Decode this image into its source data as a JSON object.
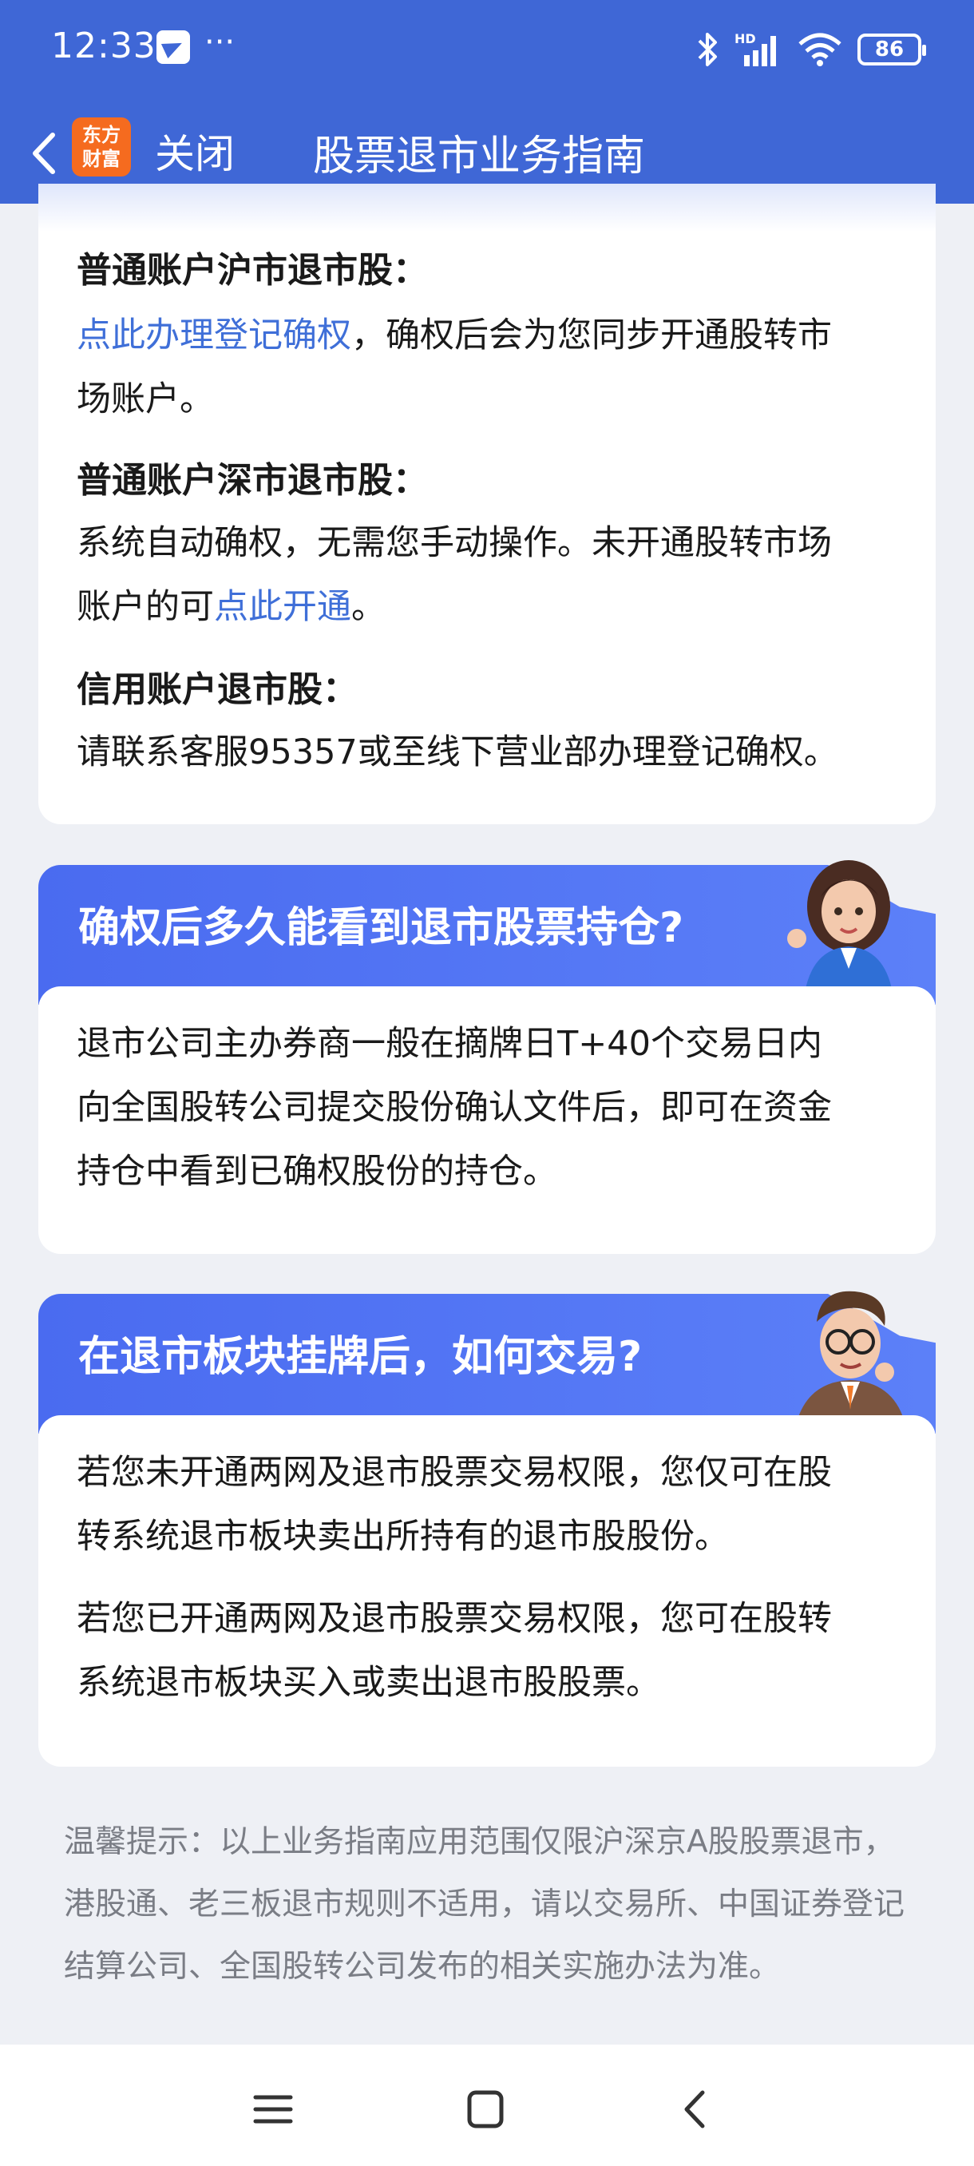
{
  "status_bar": {
    "time": "12:33",
    "dots": "···",
    "network": "HD",
    "battery": "86"
  },
  "header": {
    "logo_line1": "东方",
    "logo_line2": "财富",
    "close_label": "关闭",
    "title": "股票退市业务指南"
  },
  "card1": {
    "s1_heading": "普通账户沪市退市股：",
    "s1_link": "点此办理登记确权",
    "s1_text_a": "，确权后会为您同步开通股转市",
    "s1_text_b": "场账户。",
    "s2_heading": "普通账户深市退市股：",
    "s2_text_a": "系统自动确权，无需您手动操作。未开通股转市场",
    "s2_text_b": "账户的可",
    "s2_link": "点此开通",
    "s2_text_c": "。",
    "s3_heading": "信用账户退市股：",
    "s3_text": "请联系客服95357或至线下营业部办理登记确权。"
  },
  "section2": {
    "title": "确权后多久能看到退市股票持仓?",
    "line1": "退市公司主办券商一般在摘牌日T+40个交易日内",
    "line2": "向全国股转公司提交股份确认文件后，即可在资金",
    "line3": "持仓中看到已确权股份的持仓。"
  },
  "section3": {
    "title": "在退市板块挂牌后，如何交易?",
    "p1_line1": "若您未开通两网及退市股票交易权限，您仅可在股",
    "p1_line2": "转系统退市板块卖出所持有的退市股股份。",
    "p2_line1": "若您已开通两网及退市股票交易权限，您可在股转",
    "p2_line2": "系统退市板块买入或卖出退市股股票。"
  },
  "tip": {
    "line1": "温馨提示：以上业务指南应用范围仅限沪深京A股股票退市，",
    "line2": "港股通、老三板退市规则不适用，请以交易所、中国证券登记",
    "line3": "结算公司、全国股转公司发布的相关实施办法为准。"
  },
  "colors": {
    "brand_blue": "#3f67d6",
    "link_blue": "#3f6fd8",
    "logo_orange": "#f56b1f"
  }
}
